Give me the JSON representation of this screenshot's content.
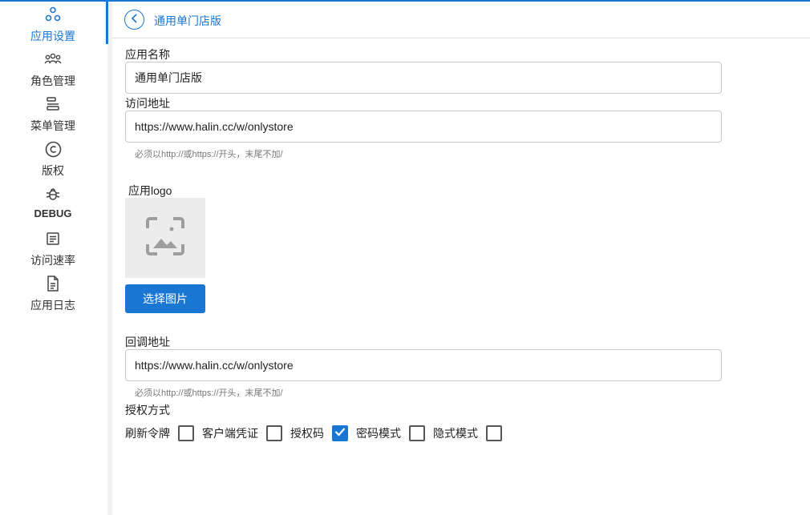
{
  "sidebar": {
    "items": [
      {
        "label": "应用设置",
        "icon": "apps-hub-icon",
        "active": true
      },
      {
        "label": "角色管理",
        "icon": "group-icon",
        "active": false
      },
      {
        "label": "菜单管理",
        "icon": "menu-bars-icon",
        "active": false
      },
      {
        "label": "版权",
        "icon": "copyright-icon",
        "active": false
      },
      {
        "label": "DEBUG",
        "icon": "bug-icon",
        "active": false
      },
      {
        "label": "访问速率",
        "icon": "document-lines-icon",
        "active": false
      },
      {
        "label": "应用日志",
        "icon": "file-text-icon",
        "active": false
      }
    ]
  },
  "header": {
    "title": "通用单门店版"
  },
  "form": {
    "app_name": {
      "label": "应用名称",
      "value": "通用单门店版"
    },
    "access_url": {
      "label": "访问地址",
      "value": "https://www.halin.cc/w/onlystore",
      "hint": "必须以http://或https://开头，末尾不加/"
    },
    "logo": {
      "label": "应用logo",
      "button_label": "选择图片"
    },
    "callback_url": {
      "label": "回调地址",
      "value": "https://www.halin.cc/w/onlystore",
      "hint": "必须以http://或https://开头，末尾不加/"
    },
    "auth": {
      "label": "授权方式",
      "options": [
        {
          "label": "刷新令牌",
          "checked": false
        },
        {
          "label": "客户端凭证",
          "checked": false
        },
        {
          "label": "授权码",
          "checked": true
        },
        {
          "label": "密码模式",
          "checked": false
        },
        {
          "label": "隐式模式",
          "checked": false
        }
      ]
    }
  },
  "colors": {
    "accent": "#1976d2",
    "logo_bg": "#ececec",
    "placeholder_icon": "#9e9e9e"
  }
}
